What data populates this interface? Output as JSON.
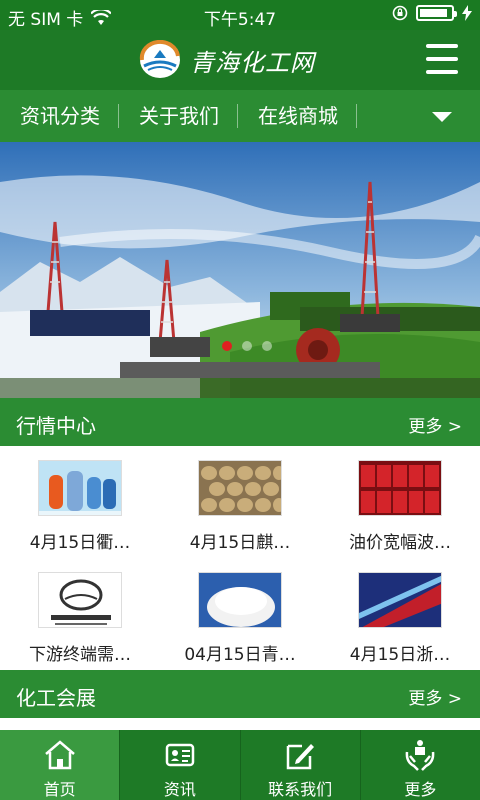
{
  "status_bar": {
    "carrier": "无 SIM 卡",
    "time": "下午5:47",
    "battery_level": 0.9
  },
  "header": {
    "logo_text": "青海化工网"
  },
  "nav": {
    "items": [
      {
        "label": "资讯分类"
      },
      {
        "label": "关于我们"
      },
      {
        "label": "在线商城"
      }
    ]
  },
  "banner": {
    "slides": 3,
    "active_slide": 1
  },
  "market": {
    "title": "行情中心",
    "more": "更多 >",
    "items": [
      {
        "caption": "4月15日衢…",
        "thumb": "refrigerant-bottles"
      },
      {
        "caption": "4月15日麒…",
        "thumb": "sacks"
      },
      {
        "caption": "油价宽幅波…",
        "thumb": "red-barrels"
      },
      {
        "caption": "下游终端需…",
        "thumb": "site-logo"
      },
      {
        "caption": "04月15日青…",
        "thumb": "white-powder"
      },
      {
        "caption": "4月15日浙…",
        "thumb": "fiber"
      }
    ]
  },
  "expo": {
    "title": "化工会展",
    "more": "更多 >"
  },
  "tabbar": {
    "items": [
      {
        "label": "首页",
        "icon": "home-icon"
      },
      {
        "label": "资讯",
        "icon": "news-card-icon"
      },
      {
        "label": "联系我们",
        "icon": "edit-icon"
      },
      {
        "label": "更多",
        "icon": "hands-icon"
      }
    ]
  },
  "colors": {
    "primary": "#1e7a26",
    "nav": "#2b8c33",
    "active_tab": "#3a9a40"
  }
}
